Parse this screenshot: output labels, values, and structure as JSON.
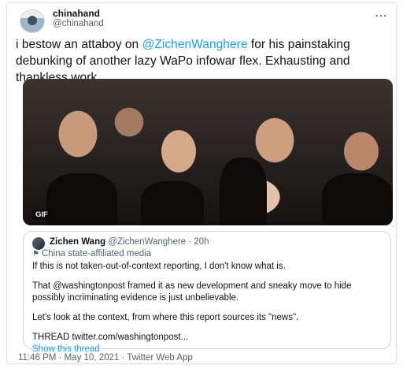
{
  "tweet": {
    "display_name": "chinahand",
    "handle": "@chinahand",
    "more_icon": "more-horizontal-icon",
    "text_before": "i bestow an attaboy on ",
    "mention": "@ZichenWanghere",
    "text_after": " for his painstaking debunking of another lazy WaPo infowar flex.  Exhausting and thankless work",
    "media_badge": "GIF",
    "timestamp": "11:46 PM · May 10, 2021 · Twitter Web App"
  },
  "quoted_tweet": {
    "name": "Zichen Wang",
    "handle_time": "@ZichenWanghere · 20h",
    "label_icon": "flag-icon",
    "label": "China state-affiliated media",
    "paragraphs": [
      "If this is not taken-out-of-context reporting, I don't know what is.",
      "That @washingtonpost framed it as new development and sneaky move to hide possibly incriminating evidence is just unbelievable.",
      "Let's look at the context, from where this report sources its \"news\".",
      "THREAD twitter.com/washingtonpost..."
    ],
    "show_thread": "Show this thread"
  },
  "colors": {
    "accent": "#1d9bf0",
    "secondary_text": "#536471",
    "border": "#cfd9de"
  }
}
